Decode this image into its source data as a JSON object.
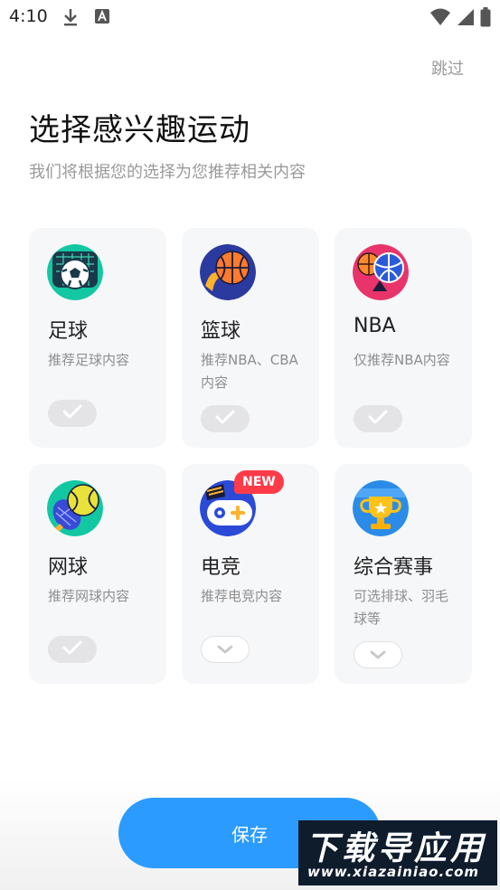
{
  "status_bar": {
    "time": "4:10",
    "icons": [
      "download-icon",
      "a-icon",
      "wifi-icon",
      "signal-icon",
      "battery-icon"
    ]
  },
  "header": {
    "skip_label": "跳过",
    "title": "选择感兴趣运动",
    "subtitle": "我们将根据您的选择为您推荐相关内容"
  },
  "cards": [
    {
      "name": "足球",
      "desc": "推荐足球内容",
      "icon": "soccer-icon",
      "selected": true
    },
    {
      "name": "篮球",
      "desc": "推荐NBA、CBA内容",
      "icon": "basketball-icon",
      "selected": true
    },
    {
      "name": "NBA",
      "desc": "仅推荐NBA内容",
      "icon": "nba-icon",
      "selected": true
    },
    {
      "name": "网球",
      "desc": "推荐网球内容",
      "icon": "tennis-icon",
      "selected": true
    },
    {
      "name": "电竞",
      "desc": "推荐电竞内容",
      "icon": "esports-icon",
      "selected": false,
      "badge": "NEW"
    },
    {
      "name": "综合赛事",
      "desc": "可选排球、羽毛球等",
      "icon": "trophy-icon",
      "selected": false
    }
  ],
  "save_label": "保存",
  "watermark": {
    "title": "下载导应用",
    "url": "www.xiazainiao.com"
  },
  "colors": {
    "accent": "#2b9bff",
    "badge": "#ff3b4a",
    "card_bg": "#f6f7f9",
    "muted": "#9a9a9a"
  }
}
